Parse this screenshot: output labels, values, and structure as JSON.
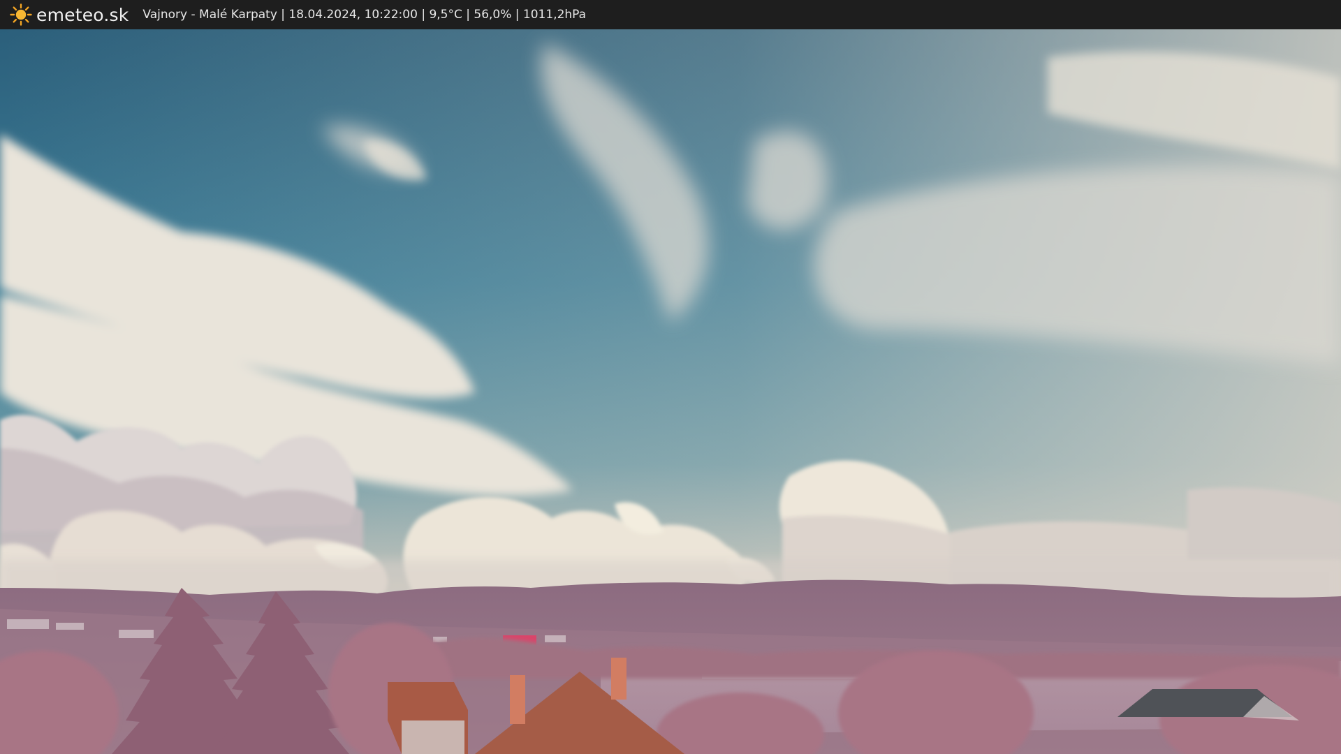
{
  "header": {
    "logo_icon": "sun-icon",
    "brand": "emeteo.sk",
    "caption": "Vajnory - Malé Karpaty | 18.04.2024, 10:22:00 | 9,5°C | 56,0% | 1011,2hPa"
  },
  "colors": {
    "bar_background": "#1e1e1e",
    "bar_text": "#f2f2f2",
    "sun": "#f5a623",
    "sky_top": "#2f6683",
    "sky_mid": "#4a8aa0",
    "cloud": "#e7e2d8",
    "hills": "#8f6f82",
    "foliage": "#9c6f7e",
    "roof": "#a85a45"
  }
}
